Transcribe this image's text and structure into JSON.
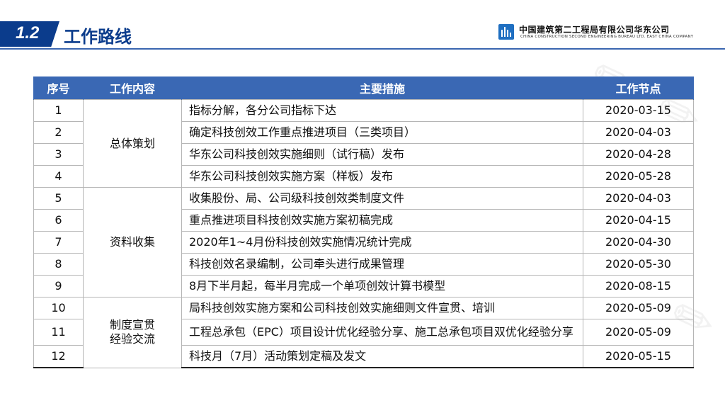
{
  "header": {
    "section_number": "1.2",
    "section_title": "工作路线",
    "company_cn": "中国建筑第二工程局有限公司华东公司",
    "company_en": "CHINA CONSTRUCTION SECOND ENGINEERING BUREAU LTD. EAST CHINA COMPANY"
  },
  "table": {
    "headers": [
      "序号",
      "工作内容",
      "主要措施",
      "工作节点"
    ],
    "categories": [
      {
        "lines": [
          "总体策划"
        ]
      },
      {
        "lines": [
          "资料收集"
        ]
      },
      {
        "lines": [
          "制度宣贯",
          "经验交流"
        ]
      }
    ],
    "rows": [
      {
        "no": "1",
        "measure": "指标分解，各分公司指标下达",
        "date": "2020-03-15"
      },
      {
        "no": "2",
        "measure": "确定科技创效工作重点推进项目（三类项目）",
        "date": "2020-04-03"
      },
      {
        "no": "3",
        "measure": "华东公司科技创效实施细则（试行稿）发布",
        "date": "2020-04-28"
      },
      {
        "no": "4",
        "measure": "华东公司科技创效实施方案（样板）发布",
        "date": "2020-05-28"
      },
      {
        "no": "5",
        "measure": "收集股份、局、公司级科技创效类制度文件",
        "date": "2020-04-03"
      },
      {
        "no": "6",
        "measure": "重点推进项目科技创效实施方案初稿完成",
        "date": "2020-04-15"
      },
      {
        "no": "7",
        "measure": "2020年1~4月份科技创效实施情况统计完成",
        "date": "2020-04-30"
      },
      {
        "no": "8",
        "measure": "科技创效名录编制，公司牵头进行成果管理",
        "date": "2020-05-30"
      },
      {
        "no": "9",
        "measure": "8月下半月起，每半月完成一个单项创效计算书模型",
        "date": "2020-08-15"
      },
      {
        "no": "10",
        "measure": "局科技创效实施方案和公司科技创效实施细则文件宣贯、培训",
        "date": "2020-05-09"
      },
      {
        "no": "11",
        "measure": "工程总承包（EPC）项目设计优化经验分享、施工总承包项目双优化经验分享",
        "date": "2020-05-09"
      },
      {
        "no": "12",
        "measure": "科技月（7月）活动策划定稿及发文",
        "date": "2020-05-15"
      }
    ]
  }
}
